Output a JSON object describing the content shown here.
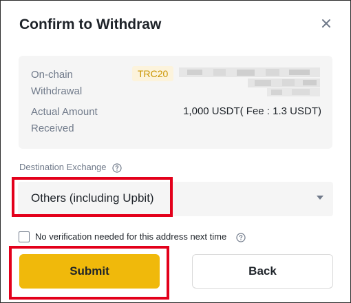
{
  "dialog": {
    "title": "Confirm to Withdraw"
  },
  "summary": {
    "onchain_label_line1": "On-chain",
    "onchain_label_line2": "Withdrawal",
    "network_badge": "TRC20",
    "received_label_line1": "Actual Amount",
    "received_label_line2": "Received",
    "received_value": "1,000 USDT( Fee : 1.3 USDT)"
  },
  "destination": {
    "label": "Destination Exchange",
    "selected": "Others (including Upbit)"
  },
  "verification": {
    "label": "No verification needed for this address next time",
    "checked": false
  },
  "actions": {
    "submit_label": "Submit",
    "back_label": "Back"
  },
  "colors": {
    "accent": "#f0b90b",
    "highlight": "#e3001b",
    "badge_bg": "#fcf3dc",
    "badge_text": "#c99400",
    "panel_bg": "#f5f5f5"
  },
  "icons": {
    "close": "close-icon",
    "help": "question-circle-icon",
    "dropdown": "caret-down-icon"
  }
}
